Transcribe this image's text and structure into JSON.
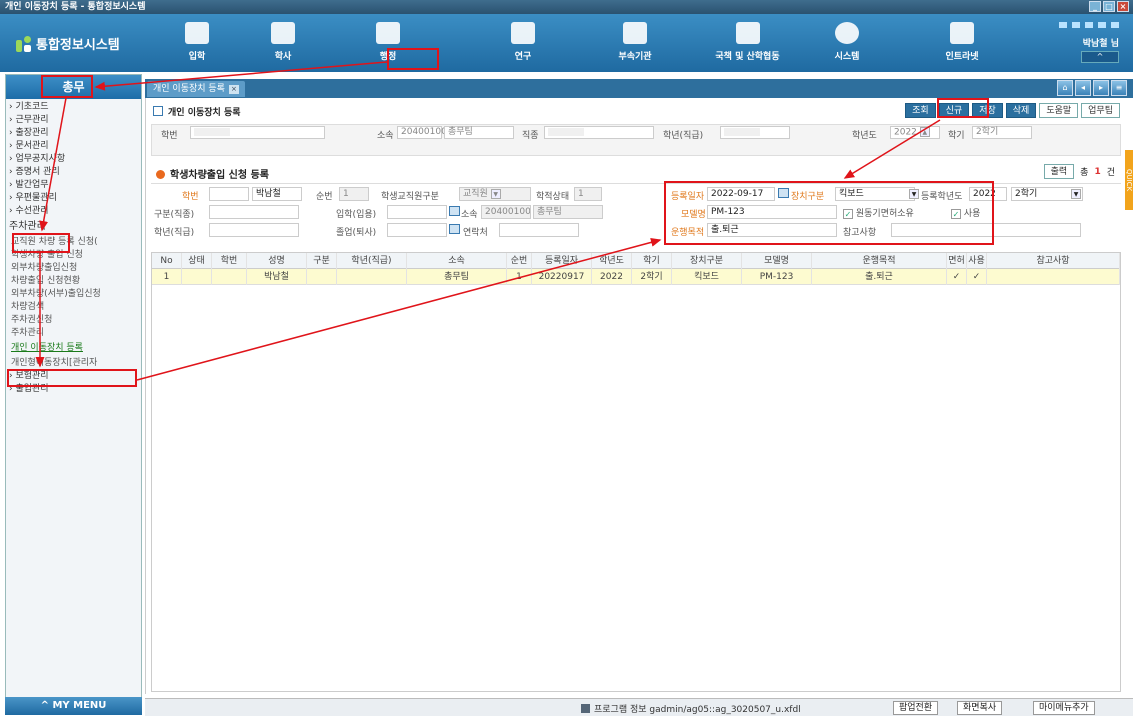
{
  "window_title": "개인 이동장치 등록 - 통합정보시스템",
  "app_name": "통합정보시스템",
  "nav": [
    {
      "label": "입학",
      "icon": "admission-icon"
    },
    {
      "label": "학사",
      "icon": "academic-icon"
    },
    {
      "label": "행정",
      "icon": "admin-icon"
    },
    {
      "label": "연구",
      "icon": "research-icon"
    },
    {
      "label": "부속기관",
      "icon": "affiliate-icon"
    },
    {
      "label": "국책 및 산학협동",
      "icon": "partnership-icon"
    },
    {
      "label": "시스템",
      "icon": "system-icon"
    },
    {
      "label": "인트라넷",
      "icon": "intranet-icon"
    }
  ],
  "user": "박남철 님",
  "sidebar": {
    "title": "총무",
    "items": [
      "› 기초코드",
      "› 근무관리",
      "› 출장관리",
      "› 문서관리",
      "› 업무공지사항",
      "› 증명서 관리",
      "› 발간업무",
      "› 우편물관리",
      "› 수선관리"
    ],
    "selected": "주차관리",
    "sub_items": [
      "교직원 차량 등록 신청(",
      "학생차량 출입 신청",
      "외부차량출입신청",
      "차량출입 신청현황",
      "외부차량(서부)출입신청",
      "차량검색",
      "주차권신청",
      "주차관리",
      "개인 이동장치 등록",
      "개인형이동장치[관리자",
      "› 보험관리",
      "› 출입관리"
    ]
  },
  "my_menu": "^ MY MENU",
  "tab": "개인 이동장치 등록",
  "page_title": "개인 이동장치 등록",
  "actions": {
    "search": "조회",
    "new": "신규",
    "save": "저장",
    "delete": "삭제",
    "help": "도움말",
    "upload": "업무팁"
  },
  "filter": {
    "student_no_label": "학번",
    "affil_label": "소속",
    "affil_code": "20400100",
    "affil_name": "총무팀",
    "job_label": "직종",
    "grade_label": "학년(직급)",
    "year_label": "학년도",
    "year": "2022",
    "term_label": "학기",
    "term": "2학기"
  },
  "section_title": "학생차량출입 신청 등록",
  "output": "출력",
  "total_prefix": "총",
  "total": "1",
  "total_suffix": "건",
  "form": {
    "hakbun_label": "학번",
    "name": "박남철",
    "seq_label": "순번",
    "seq": "1",
    "type_label": "학생교직원구분",
    "type": "교직원",
    "status_label": "학적상태",
    "status": "1",
    "reg_date_label": "등록일자",
    "reg_date": "2022-09-17",
    "device_type_label": "장치구분",
    "device_type": "킥보드",
    "reg_year_label": "등록학년도",
    "reg_year": "2022",
    "reg_term": "2학기",
    "dept_label": "구분(직종)",
    "enter_label": "입학(입용)",
    "affil_label": "소속",
    "affil_code": "20400100",
    "affil_name": "총무팀",
    "model_label": "모델명",
    "model": "PM-123",
    "license_label": "원동기면허소유",
    "use_label": "사용",
    "grade_label": "학년(직급)",
    "grad_label": "졸업(퇴사)",
    "phone_label": "연락처",
    "purpose_label": "운행목적",
    "purpose": "출.퇴근",
    "note_label": "참고사항"
  },
  "grid": {
    "headers": [
      "No",
      "상태",
      "학번",
      "성명",
      "구분",
      "학년(직급)",
      "소속",
      "순번",
      "등록일자",
      "학년도",
      "학기",
      "장치구분",
      "모델명",
      "운행목적",
      "면허",
      "사용",
      "참고사항"
    ],
    "rows": [
      [
        "1",
        "",
        "",
        "박남철",
        "",
        "",
        "총무팀",
        "1",
        "20220917",
        "2022",
        "2학기",
        "킥보드",
        "PM-123",
        "출.퇴근",
        "✓",
        "✓",
        ""
      ]
    ]
  },
  "status": {
    "program": "프로그램 정보  gadmin/ag05::ag_3020507_u.xfdl",
    "popup": "팝업전환",
    "copy": "화면복사",
    "mymenu": "마이메뉴추가"
  },
  "quick": "QUICK"
}
